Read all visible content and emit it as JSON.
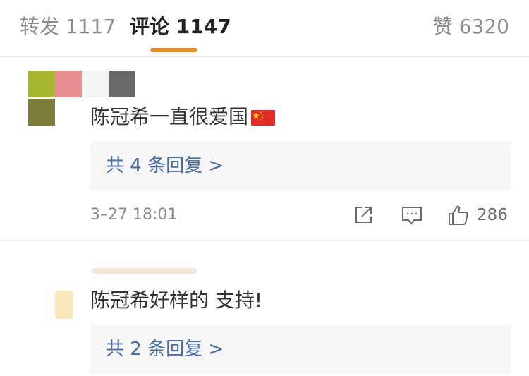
{
  "tabs": {
    "repost": "转发 1117",
    "comment": "评论 1147",
    "like": "赞 6320",
    "active": "comment",
    "accent_color": "#f08a1d"
  },
  "comments": [
    {
      "text": "陈冠希一直很爱国",
      "emoji": "china-flag-icon",
      "replies_label": "共 4 条回复 >",
      "time": "3–27 18:01",
      "like_count": "286"
    },
    {
      "text": "陈冠希好样的 支持!",
      "replies_label": "共 2 条回复 >"
    }
  ],
  "icons": {
    "share": "share-icon",
    "reply": "comment-icon",
    "like": "thumbs-up-icon"
  },
  "colors": {
    "link": "#4a6ea9",
    "muted": "#8c8c8c",
    "reply_bg": "#f6f6f6"
  }
}
